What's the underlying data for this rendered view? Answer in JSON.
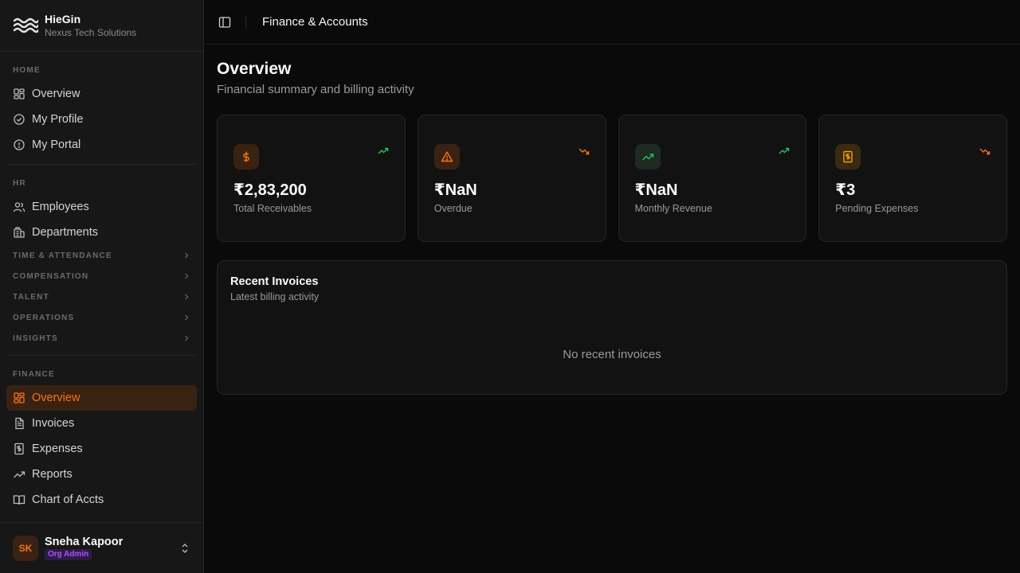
{
  "brand": {
    "name": "HieGin",
    "org": "Nexus Tech Solutions"
  },
  "sidebar": {
    "home": {
      "label": "HOME",
      "items": [
        {
          "label": "Overview",
          "icon": "grid-icon"
        },
        {
          "label": "My Profile",
          "icon": "check-circle-icon"
        },
        {
          "label": "My Portal",
          "icon": "alert-circle-icon"
        }
      ]
    },
    "hr": {
      "label": "HR",
      "items": [
        {
          "label": "Employees",
          "icon": "users-icon"
        },
        {
          "label": "Departments",
          "icon": "building-icon"
        }
      ]
    },
    "groups": [
      "TIME & ATTENDANCE",
      "COMPENSATION",
      "TALENT",
      "OPERATIONS",
      "INSIGHTS"
    ],
    "finance": {
      "label": "FINANCE",
      "items": [
        {
          "label": "Overview",
          "icon": "grid-icon",
          "active": true
        },
        {
          "label": "Invoices",
          "icon": "file-text-icon"
        },
        {
          "label": "Expenses",
          "icon": "receipt-icon"
        },
        {
          "label": "Reports",
          "icon": "trending-up-icon"
        },
        {
          "label": "Chart of Accts",
          "icon": "book-icon"
        }
      ]
    }
  },
  "user": {
    "initials": "SK",
    "name": "Sneha Kapoor",
    "role": "Org Admin"
  },
  "topbar": {
    "title": "Finance & Accounts"
  },
  "page": {
    "title": "Overview",
    "subtitle": "Financial summary and billing activity"
  },
  "stats": [
    {
      "value": "₹2,83,200",
      "label": "Total Receivables",
      "icon": "dollar-icon",
      "trend": "up"
    },
    {
      "value": "₹NaN",
      "label": "Overdue",
      "icon": "warning-icon",
      "trend": "down"
    },
    {
      "value": "₹NaN",
      "label": "Monthly Revenue",
      "icon": "trending-up-icon",
      "trend": "up"
    },
    {
      "value": "₹3",
      "label": "Pending Expenses",
      "icon": "receipt-icon",
      "trend": "down"
    }
  ],
  "invoices": {
    "title": "Recent Invoices",
    "subtitle": "Latest billing activity",
    "empty": "No recent invoices"
  },
  "colors": {
    "accent": "#f97316",
    "up": "#22c55e",
    "down": "#f97316",
    "role": "#a855f7"
  }
}
